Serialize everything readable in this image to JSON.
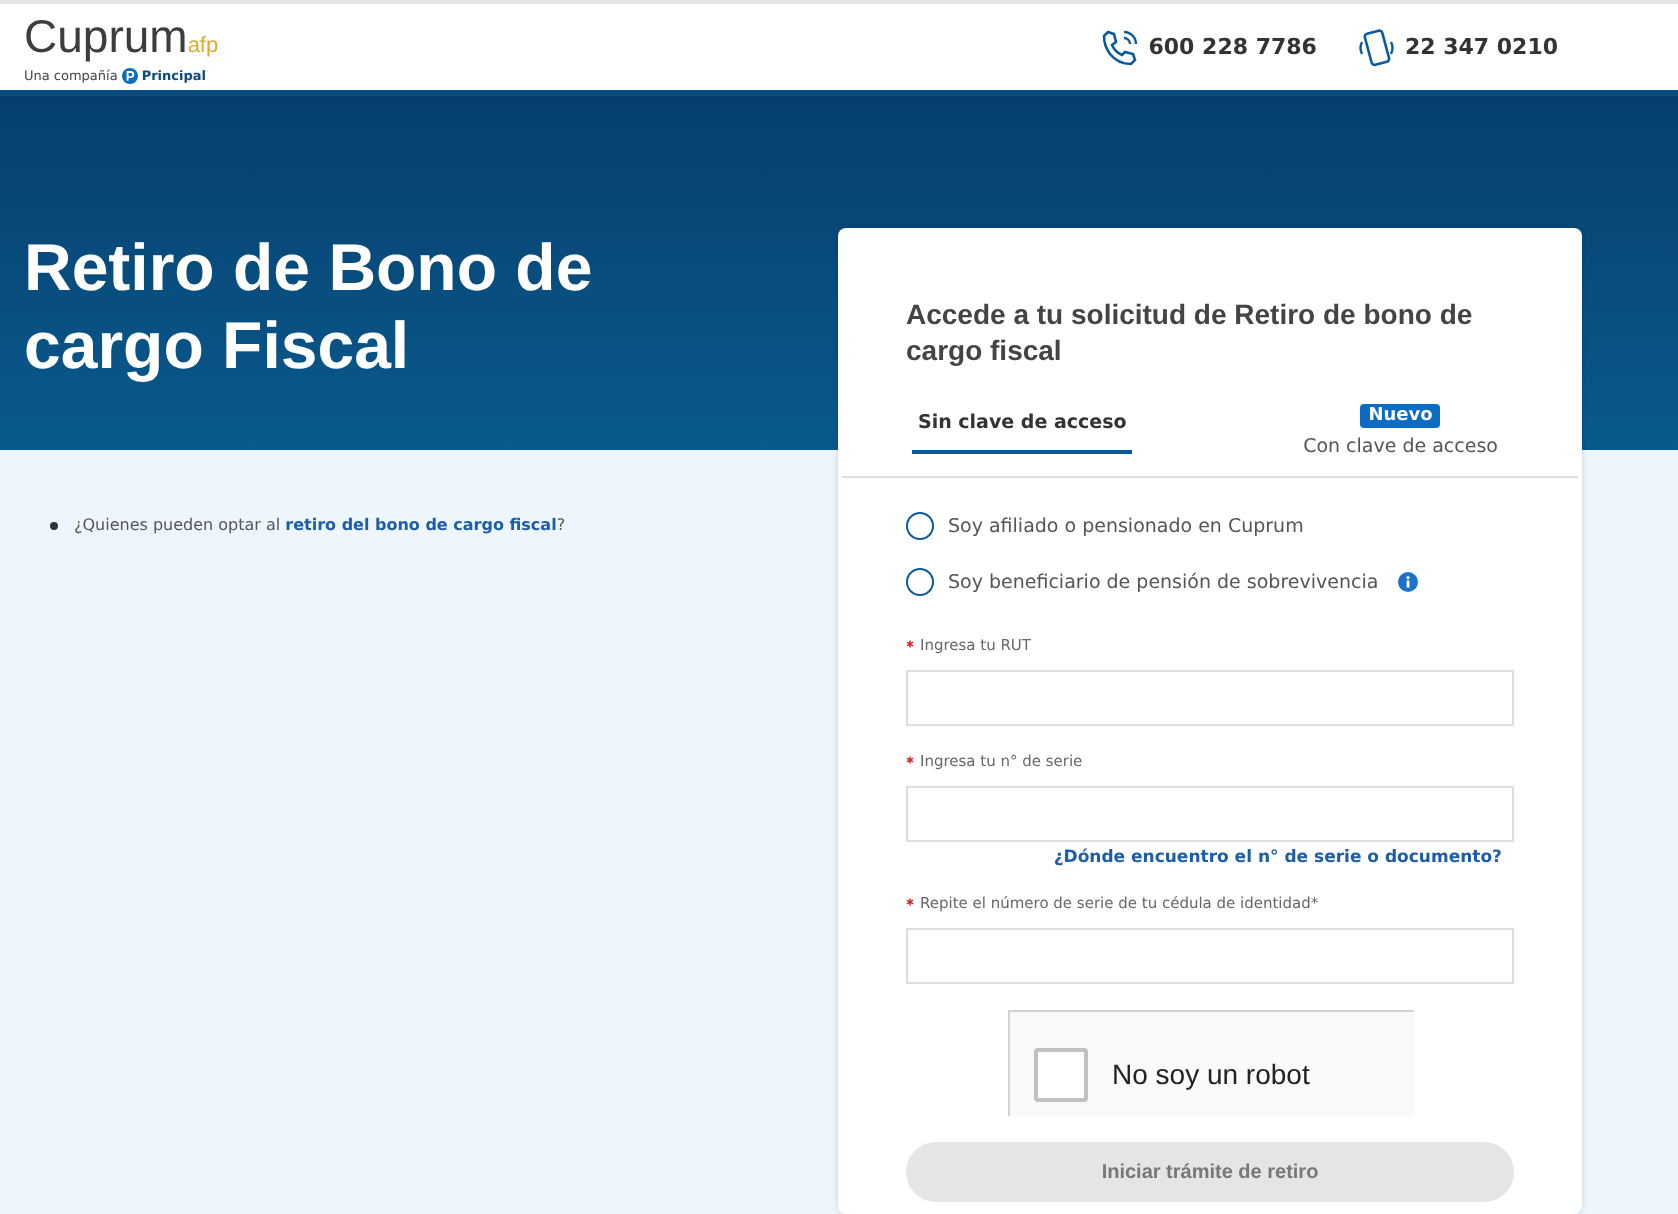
{
  "header": {
    "logo": {
      "name": "Cuprum",
      "suffix": "afp",
      "tagline": "Una compañía",
      "partner": "Principal"
    },
    "phones": [
      {
        "kind": "phone",
        "number": "600 228 7786"
      },
      {
        "kind": "mobile",
        "number": "22 347 0210"
      }
    ]
  },
  "hero": {
    "title": "Retiro de Bono de cargo Fiscal"
  },
  "info": [
    {
      "before": "¿Quienes pueden optar al ",
      "link": "retiro del bono de cargo fiscal",
      "after": "?"
    }
  ],
  "card": {
    "title": "Accede a tu solicitud de Retiro de bono de cargo fiscal",
    "tabs": [
      {
        "label": "Sin clave de acceso",
        "selected": true
      },
      {
        "label": "Con clave de acceso",
        "selected": false,
        "badge": "Nuevo"
      }
    ],
    "options": [
      {
        "label": "Soy afiliado o pensionado en Cuprum",
        "selected": false,
        "info": false
      },
      {
        "label": "Soy beneficiario de pensión de sobrevivencia",
        "selected": false,
        "info": true
      }
    ],
    "fields": [
      {
        "label": "Ingresa tu RUT",
        "required": true
      },
      {
        "label": "Ingresa tu n° de serie",
        "required": true,
        "help_link": "¿Dónde encuentro el n° de serie o documento?"
      },
      {
        "label": "Repite el número de serie de tu cédula de identidad*",
        "required": true
      }
    ],
    "captcha": {
      "label": "No soy un robot",
      "checked": false
    },
    "button": {
      "label": "Iniciar trámite de retiro",
      "disabled": true
    }
  }
}
